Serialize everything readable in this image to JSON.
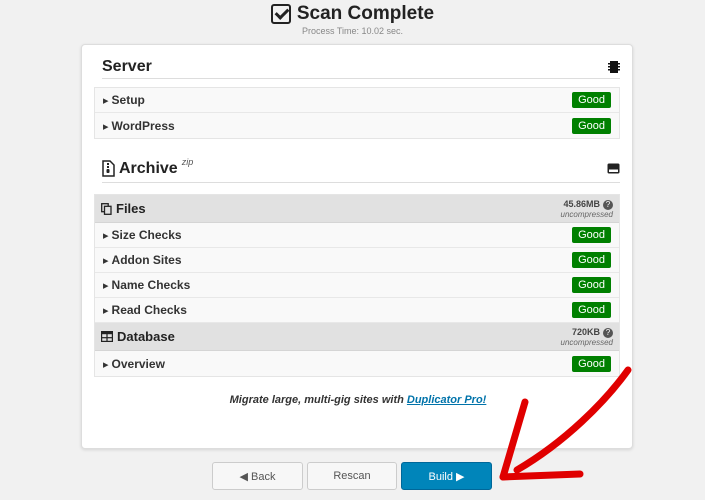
{
  "header": {
    "title": "Scan Complete",
    "process_time": "Process Time: 10.02 sec."
  },
  "server": {
    "title": "Server",
    "items": [
      {
        "label": "Setup",
        "status": "Good"
      },
      {
        "label": "WordPress",
        "status": "Good"
      }
    ]
  },
  "archive": {
    "title": "Archive",
    "format": "zip",
    "files": {
      "title": "Files",
      "size": "45.86MB",
      "size_note": "uncompressed",
      "items": [
        {
          "label": "Size Checks",
          "status": "Good"
        },
        {
          "label": "Addon Sites",
          "status": "Good"
        },
        {
          "label": "Name Checks",
          "status": "Good"
        },
        {
          "label": "Read Checks",
          "status": "Good"
        }
      ]
    },
    "database": {
      "title": "Database",
      "size": "720KB",
      "size_note": "uncompressed",
      "items": [
        {
          "label": "Overview",
          "status": "Good"
        }
      ]
    }
  },
  "promo": {
    "text": "Migrate large, multi-gig sites with ",
    "link": "Duplicator Pro!"
  },
  "buttons": {
    "back": "◀ Back",
    "rescan": "Rescan",
    "build": "Build ▶"
  },
  "colors": {
    "good": "#008000",
    "primary": "#0085ba",
    "arrow": "#e00000"
  }
}
